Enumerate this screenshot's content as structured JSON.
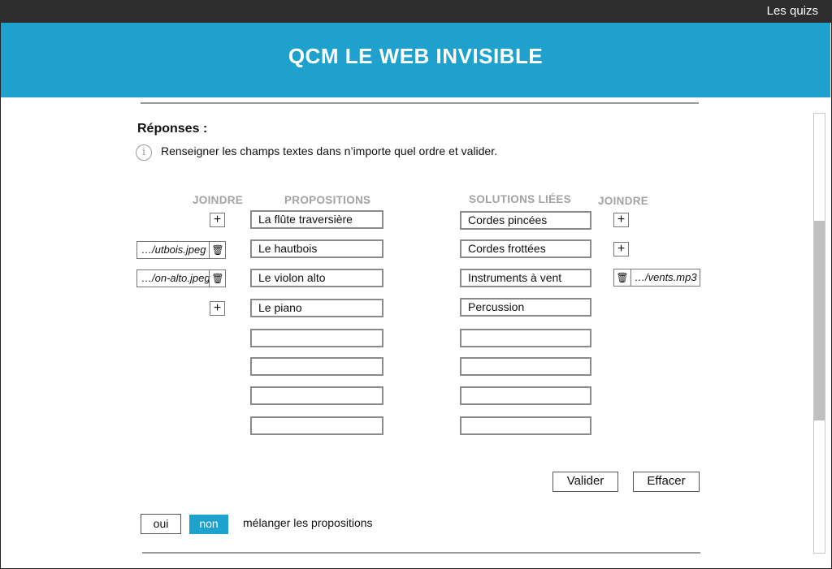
{
  "topbar": {
    "quizzes_link": "Les quizs"
  },
  "banner": {
    "title": "QCM LE WEB INVISIBLE"
  },
  "section": {
    "title": "Réponses :",
    "info": "Renseigner les champs textes dans n’importe quel ordre et valider."
  },
  "columns": {
    "join_left": "JOINDRE",
    "propositions": "PROPOSITIONS",
    "solutions": "SOLUTIONS LIÉES",
    "join_right": "JOINDRE"
  },
  "propositions": [
    "La flûte traversière",
    "Le hautbois",
    "Le violon alto",
    "Le piano",
    "",
    "",
    "",
    ""
  ],
  "solutions": [
    "Cordes pincées",
    "Cordes frottées",
    "Instruments à vent",
    "Percussion",
    "",
    "",
    "",
    ""
  ],
  "attachments": {
    "left_row2": "…/utbois.jpeg",
    "left_row3": "…/on-alto.jpeg",
    "right_row3": "…/vents.mp3"
  },
  "icons": {
    "plus": "+",
    "trash": "🗑",
    "info": "i"
  },
  "actions": {
    "validate": "Valider",
    "clear": "Effacer"
  },
  "shuffle": {
    "yes": "oui",
    "no": "non",
    "label": "mélanger les propositions",
    "selected": "non"
  },
  "colors": {
    "accent": "#1ea1cd",
    "topbar": "#2d2d2d",
    "header_text": "#a3a3a3"
  }
}
